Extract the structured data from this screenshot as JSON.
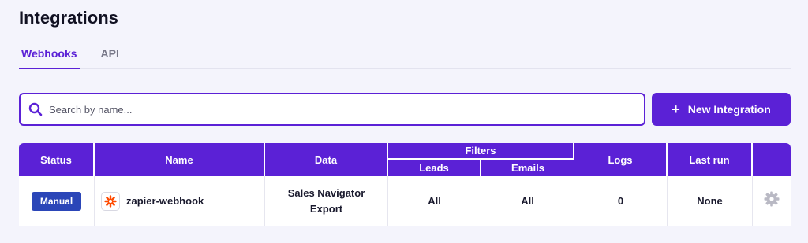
{
  "page": {
    "title": "Integrations"
  },
  "tabs": [
    {
      "label": "Webhooks",
      "active": true
    },
    {
      "label": "API",
      "active": false
    }
  ],
  "search": {
    "placeholder": "Search by name...",
    "value": ""
  },
  "new_button": {
    "label": "New Integration",
    "icon": "plus-icon"
  },
  "table": {
    "headers": {
      "status": "Status",
      "name": "Name",
      "data": "Data",
      "filters": "Filters",
      "leads": "Leads",
      "emails": "Emails",
      "logs": "Logs",
      "last_run": "Last run"
    },
    "rows": [
      {
        "status": "Manual",
        "name": "zapier-webhook",
        "name_icon": "zapier-logo-icon",
        "data_line1": "Sales Navigator",
        "data_line2": "Export",
        "leads": "All",
        "emails": "All",
        "logs": "0",
        "last_run": "None",
        "action_icon": "gear-icon"
      }
    ]
  },
  "colors": {
    "accent": "#5b21d6",
    "badge": "#2b46b8",
    "background": "#f4f4fc",
    "zapier": "#ff4a00"
  }
}
